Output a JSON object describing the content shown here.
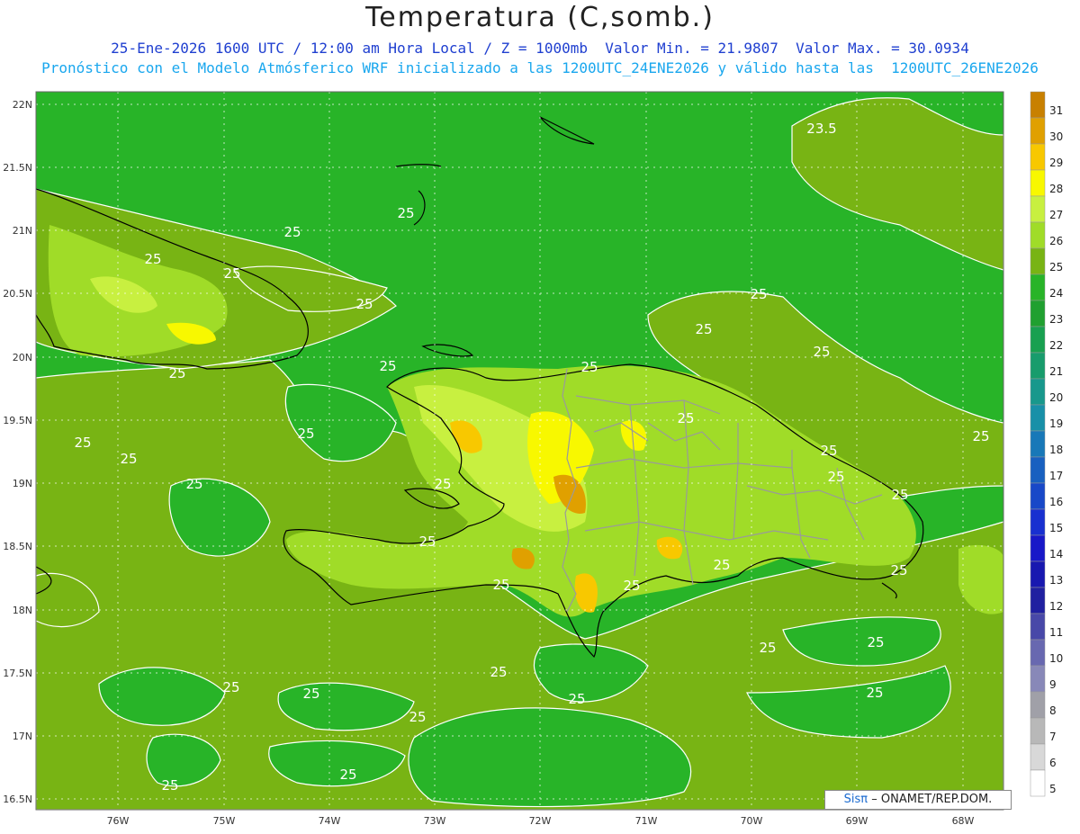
{
  "header": {
    "title": "Temperatura (C,somb.)",
    "line1": "25-Ene-2026 1600 UTC / 12:00 am Hora Local / Z = 1000mb  Valor Min. = 21.9807  Valor Max. = 30.0934",
    "line2": "Pronóstico con el Modelo Atmósferico WRF inicializado a las 1200UTC_24ENE2026 y válido hasta las  1200UTC_26ENE2026"
  },
  "axes": {
    "lat_labels": [
      "22N",
      "21.5N",
      "21N",
      "20.5N",
      "20N",
      "19.5N",
      "19N",
      "18.5N",
      "18N",
      "17.5N",
      "17N",
      "16.5N"
    ],
    "lon_labels": [
      "76W",
      "75W",
      "74W",
      "73W",
      "72W",
      "71W",
      "70W",
      "69W",
      "68W"
    ]
  },
  "colorbar": {
    "levels": [
      "31",
      "30",
      "29",
      "28",
      "27",
      "26",
      "25",
      "24",
      "23",
      "22",
      "21",
      "20",
      "19",
      "18",
      "17",
      "16",
      "15",
      "14",
      "13",
      "12",
      "11",
      "10",
      "9",
      "8",
      "7",
      "6",
      "5"
    ],
    "colors": [
      "#c88000",
      "#e0a000",
      "#f8c800",
      "#f8f800",
      "#c8f040",
      "#a0dc28",
      "#78b414",
      "#28b428",
      "#20a030",
      "#18a050",
      "#189c6c",
      "#18988c",
      "#1890a8",
      "#1878b8",
      "#1860c0",
      "#1848c8",
      "#1830d0",
      "#1818c8",
      "#1818b0",
      "#2020a0",
      "#4848a8",
      "#6868b0",
      "#8888b8",
      "#a0a0a8",
      "#b8b8b8",
      "#d8d8d8",
      "#ffffff"
    ]
  },
  "contour_labels": [
    "25",
    "25",
    "25",
    "25",
    "25",
    "25",
    "25",
    "25",
    "25",
    "25",
    "25",
    "25",
    "25",
    "25",
    "25",
    "25",
    "25",
    "25",
    "25",
    "25",
    "25",
    "25",
    "25",
    "25",
    "25",
    "25",
    "25",
    "25",
    "25",
    "25",
    "23.5"
  ],
  "credit": {
    "brand": "Sisπ",
    "text": "– ONAMET/REP.DOM."
  }
}
